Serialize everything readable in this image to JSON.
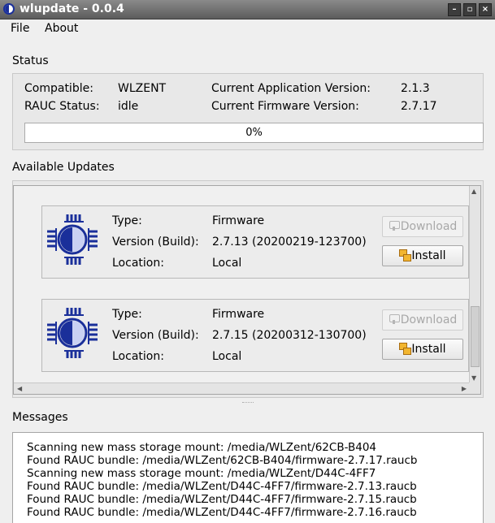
{
  "window": {
    "title": "wlupdate - 0.0.4",
    "buttons": [
      "–",
      "▫",
      "×"
    ]
  },
  "menu": {
    "file": "File",
    "about": "About"
  },
  "status": {
    "heading": "Status",
    "compatible_label": "Compatible:",
    "compatible_value": "WLZENT",
    "rauc_label": "RAUC Status:",
    "rauc_value": "idle",
    "app_version_label": "Current Application Version:",
    "app_version_value": "2.1.3",
    "fw_version_label": "Current Firmware Version:",
    "fw_version_value": "2.7.17",
    "progress_percent": 0,
    "progress_text": "0%"
  },
  "updates": {
    "heading": "Available Updates",
    "items": [
      {
        "type_label": "Type:",
        "type_value": "Firmware",
        "version_label": "Version (Build):",
        "version_value": "2.7.13 (20200219-123700)",
        "location_label": "Location:",
        "location_value": "Local",
        "download_label": "Download",
        "install_label": "Install"
      },
      {
        "type_label": "Type:",
        "type_value": "Firmware",
        "version_label": "Version (Build):",
        "version_value": "2.7.15 (20200312-130700)",
        "location_label": "Location:",
        "location_value": "Local",
        "download_label": "Download",
        "install_label": "Install"
      }
    ]
  },
  "messages": {
    "heading": "Messages",
    "lines": [
      "Scanning new mass storage mount: /media/WLZent/62CB-B404",
      "Found RAUC bundle: /media/WLZent/62CB-B404/firmware-2.7.17.raucb",
      "Scanning new mass storage mount: /media/WLZent/D44C-4FF7",
      "Found RAUC bundle: /media/WLZent/D44C-4FF7/firmware-2.7.13.raucb",
      "Found RAUC bundle: /media/WLZent/D44C-4FF7/firmware-2.7.15.raucb",
      "Found RAUC bundle: /media/WLZent/D44C-4FF7/firmware-2.7.16.raucb"
    ]
  },
  "colors": {
    "accent": "#1a2f9a",
    "progress": "#3d7bd6",
    "titlebar": "#6e6e6e"
  }
}
